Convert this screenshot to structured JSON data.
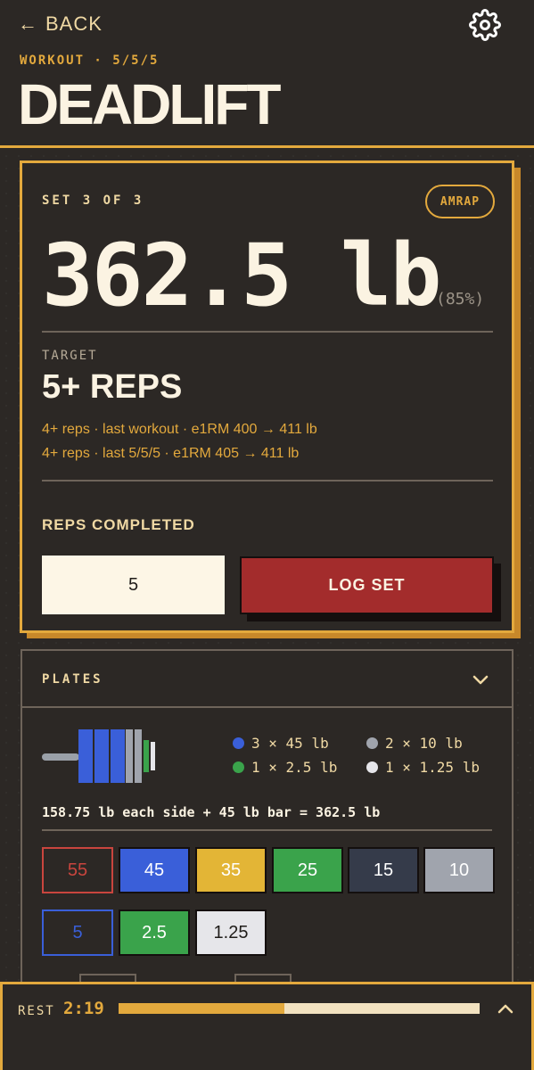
{
  "header": {
    "back_label": "BACK",
    "kicker": "WORKOUT · 5/5/5",
    "title": "DEADLIFT"
  },
  "set_card": {
    "set_label": "SET 3 OF 3",
    "amrap_label": "AMRAP",
    "weight": "362.5 lb",
    "percent": "(85%)",
    "target_label": "TARGET",
    "target_value": "5+ REPS",
    "history": [
      "4+ reps · last workout · e1RM 400 → 411 lb",
      "4+ reps · last 5/5/5 · e1RM 405 → 411 lb"
    ],
    "reps_label": "REPS COMPLETED",
    "reps_value": "5",
    "log_button": "LOG SET"
  },
  "plates": {
    "title": "PLATES",
    "legend": [
      {
        "text": "3 × 45 lb",
        "color": "#3a5fd9"
      },
      {
        "text": "2 × 10 lb",
        "color": "#a0a4ad"
      },
      {
        "text": "1 × 2.5 lb",
        "color": "#3aa34b"
      },
      {
        "text": "1 × 1.25 lb",
        "color": "#e6e6ea"
      }
    ],
    "equation": "158.75 lb each side + 45 lb bar = 362.5 lb",
    "chips": [
      {
        "label": "55",
        "bg": "#2c2825",
        "fg": "#c9453e",
        "border": "#c9453e"
      },
      {
        "label": "45",
        "bg": "#3a5fd9",
        "fg": "#ffffff",
        "border": "#140f0e"
      },
      {
        "label": "35",
        "bg": "#e3b536",
        "fg": "#ffffff",
        "border": "#140f0e"
      },
      {
        "label": "25",
        "bg": "#3aa34b",
        "fg": "#ffffff",
        "border": "#140f0e"
      },
      {
        "label": "15",
        "bg": "#353b4a",
        "fg": "#ffffff",
        "border": "#140f0e"
      },
      {
        "label": "10",
        "bg": "#a0a4ad",
        "fg": "#ffffff",
        "border": "#140f0e"
      },
      {
        "label": "5",
        "bg": "#2c2825",
        "fg": "#3a5fd9",
        "border": "#3a5fd9"
      },
      {
        "label": "2.5",
        "bg": "#3aa34b",
        "fg": "#ffffff",
        "border": "#140f0e"
      },
      {
        "label": "1.25",
        "bg": "#e6e6ea",
        "fg": "#1f1c19",
        "border": "#140f0e"
      }
    ]
  },
  "rest": {
    "label": "REST",
    "time": "2:19",
    "progress": 0.46
  },
  "colors": {
    "accent": "#e3a93d",
    "danger": "#a32c2c",
    "background": "#2c2825"
  }
}
